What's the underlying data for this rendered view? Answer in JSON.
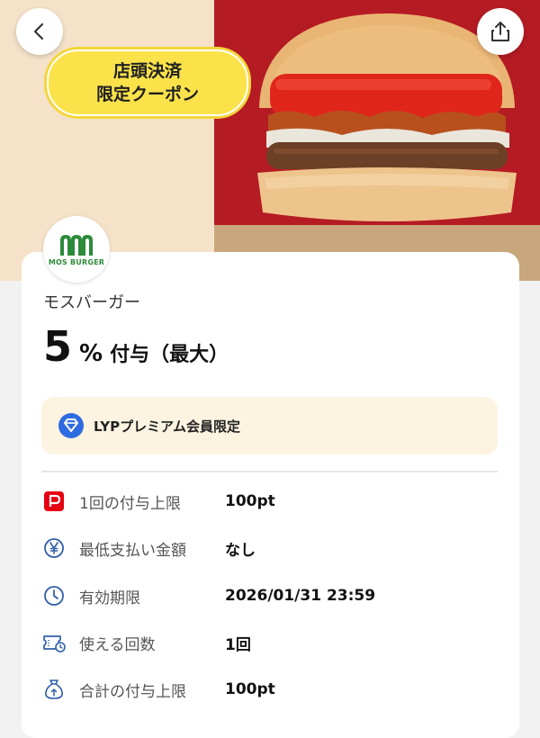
{
  "hero": {
    "badge_line1": "店頭決済",
    "badge_line2": "限定クーポン"
  },
  "logo": {
    "text": "MOS BURGER",
    "color": "#2d8a3a"
  },
  "shop": {
    "name": "モスバーガー"
  },
  "discount": {
    "number": "5",
    "unit": "%",
    "text": "付与（最大）"
  },
  "premium": {
    "label": "LYPプレミアム会員限定",
    "bg": "#fdf3e1",
    "icon": "lyp-premium-icon"
  },
  "details": [
    {
      "icon": "paypay-icon",
      "label": "1回の付与上限",
      "value": "100pt"
    },
    {
      "icon": "yen-icon",
      "label": "最低支払い金額",
      "value": "なし"
    },
    {
      "icon": "clock-icon",
      "label": "有効期限",
      "value": "2026/01/31 23:59"
    },
    {
      "icon": "ticket-icon",
      "label": "使える回数",
      "value": "1回"
    },
    {
      "icon": "money-bag-icon",
      "label": "合計の付与上限",
      "value": "100pt"
    }
  ],
  "colors": {
    "badge": "#fbe24a",
    "accent_red": "#e60012",
    "icon_blue": "#2f5fa8"
  }
}
